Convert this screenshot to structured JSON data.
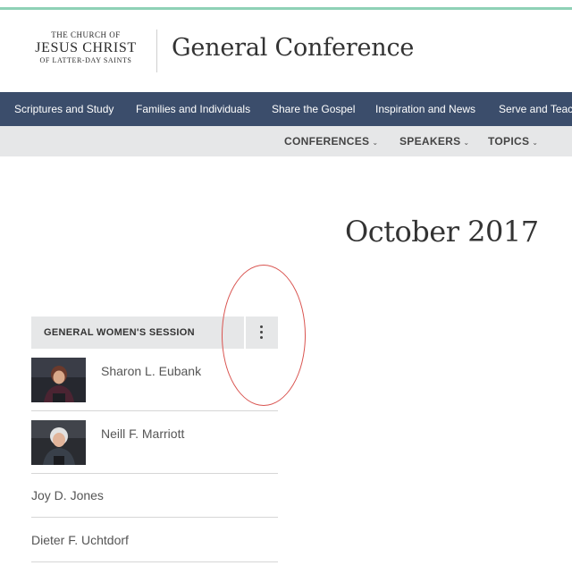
{
  "logo": {
    "line1": "THE CHURCH OF",
    "line2": "JESUS CHRIST",
    "line3": "OF LATTER-DAY SAINTS"
  },
  "site_title": "General Conference",
  "main_nav": [
    "Scriptures and Study",
    "Families and Individuals",
    "Share the Gospel",
    "Inspiration and News",
    "Serve and Teac"
  ],
  "sub_nav": [
    "CONFERENCES",
    "SPEAKERS",
    "TOPICS"
  ],
  "page_heading": "October 2017",
  "session": {
    "title": "GENERAL WOMEN'S SESSION"
  },
  "speakers": [
    "Sharon L. Eubank",
    "Neill F. Marriott",
    "Joy D. Jones",
    "Dieter F. Uchtdorf"
  ],
  "colors": {
    "nav_bg": "#3b4d6b",
    "subnav_bg": "#e6e7e8",
    "accent_line": "#8fd1b6",
    "annotation": "#d9534f"
  }
}
